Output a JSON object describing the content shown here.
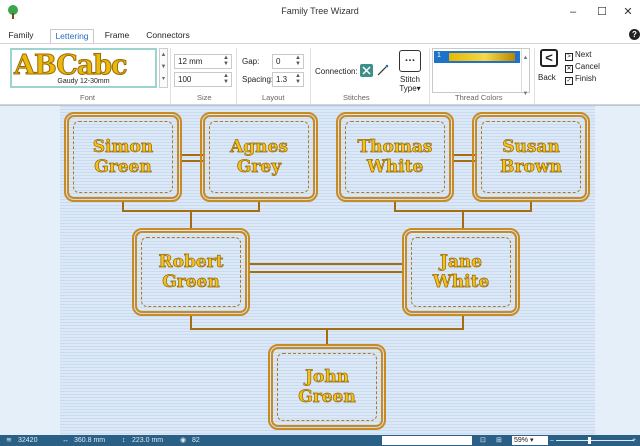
{
  "window": {
    "title": "Family Tree Wizard",
    "minimize": "–",
    "maximize": "☐",
    "close": "✕"
  },
  "tabs": [
    {
      "label": "Family"
    },
    {
      "label": "Lettering"
    },
    {
      "label": "Frame"
    },
    {
      "label": "Connectors"
    }
  ],
  "help_glyph": "?",
  "ribbon": {
    "font": {
      "preview": "ABCabc",
      "name": "Gaudy 12-30mm",
      "group": "Font"
    },
    "size": {
      "height": "12 mm",
      "width": "100",
      "group": "Size"
    },
    "layout": {
      "gap_label": "Gap:",
      "gap": "0",
      "spacing_label": "Spacing:",
      "spacing": "1.3",
      "group": "Layout"
    },
    "stitches": {
      "connection_label": "Connection:",
      "stitch_type_label": "Stitch Type",
      "stitch_type_arrow": "▾",
      "group": "Stitches"
    },
    "thread_colors": {
      "group": "Thread Colors",
      "items": [
        {
          "number": "1",
          "color": "#e6b800"
        }
      ]
    },
    "nav": {
      "back": "Back",
      "next": "Next",
      "cancel": "Cancel",
      "finish": "Finish"
    }
  },
  "tree": [
    {
      "name": "Simon\nGreen"
    },
    {
      "name": "Agnes\nGrey"
    },
    {
      "name": "Thomas\nWhite"
    },
    {
      "name": "Susan\nBrown"
    },
    {
      "name": "Robert\nGreen"
    },
    {
      "name": "Jane\nWhite"
    },
    {
      "name": "John\nGreen"
    }
  ],
  "colors": {
    "thread": "#f3c21b",
    "outline": "#9a6805",
    "connector": "#a46d14",
    "canvas": "#e5effa"
  },
  "status": {
    "stitches": "32420",
    "width": "360.8 mm",
    "height": "223.0 mm",
    "colors": "82",
    "zoom": "59%"
  }
}
